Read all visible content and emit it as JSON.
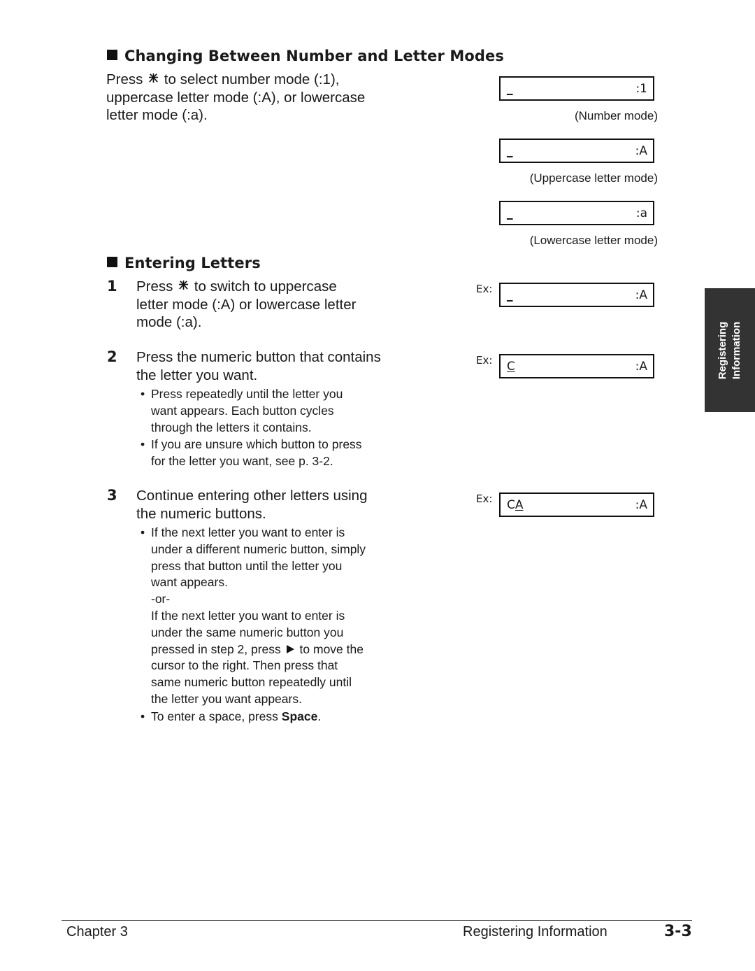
{
  "section1": {
    "heading": "Changing Between Number and Letter Modes",
    "text_before_icon": "Press",
    "icon": "star-key-icon",
    "line1_after_icon": " to select number mode (:1),",
    "line2": "uppercase letter mode (:A), or lowercase",
    "line3": "letter mode (:a).",
    "displays": [
      {
        "cursor": "_",
        "mode": ":1",
        "caption": "(Number mode)"
      },
      {
        "cursor": "_",
        "mode": ":A",
        "caption": "(Uppercase letter mode)"
      },
      {
        "cursor": "_",
        "mode": ":a",
        "caption": "(Lowercase letter mode)"
      }
    ]
  },
  "section2": {
    "heading": "Entering Letters",
    "steps": [
      {
        "number": "1",
        "text_before_icon": "Press",
        "line1_after_icon": " to switch to uppercase",
        "line2": "letter mode (:A) or lowercase letter",
        "line3": "mode (:a).",
        "example": {
          "label": "Ex:",
          "text": "",
          "cursor": "_",
          "mode": ":A"
        }
      },
      {
        "number": "2",
        "line1": "Press the numeric button that contains",
        "line2": "the letter you want.",
        "bullets": [
          [
            "Press repeatedly until the letter you",
            "want appears. Each button cycles",
            "through the letters it contains."
          ],
          [
            "If you are unsure which button to press",
            "for the letter you want, see p. 3-2."
          ]
        ],
        "example": {
          "label": "Ex:",
          "text": "",
          "cursor": "C",
          "mode": ":A"
        }
      },
      {
        "number": "3",
        "line1": "Continue entering other letters using",
        "line2": "the numeric buttons.",
        "bullet1": [
          "If the next letter you want to enter is",
          "under a different numeric button, simply",
          "press that button until the letter you",
          "want appears."
        ],
        "or": "-or-",
        "alt": {
          "line1": "If the next letter you want to enter is",
          "line2": "under the same numeric button you",
          "line3_before_icon": "pressed in step 2, press",
          "icon": "right-arrow-key-icon",
          "line3_after_icon": " to move the",
          "line4": "cursor to the right. Then press that",
          "line5": "same numeric button repeatedly until",
          "line6": "the letter you want appears."
        },
        "bullet2_before": "To enter a space, press ",
        "bullet2_bold": "Space",
        "bullet2_after": ".",
        "example": {
          "label": "Ex:",
          "text": "C",
          "cursor": "A",
          "mode": ":A"
        }
      }
    ]
  },
  "side_tab": {
    "line1": "Registering",
    "line2": "Information"
  },
  "footer": {
    "chapter": "Chapter 3",
    "section": "Registering Information",
    "page": "3-3"
  }
}
